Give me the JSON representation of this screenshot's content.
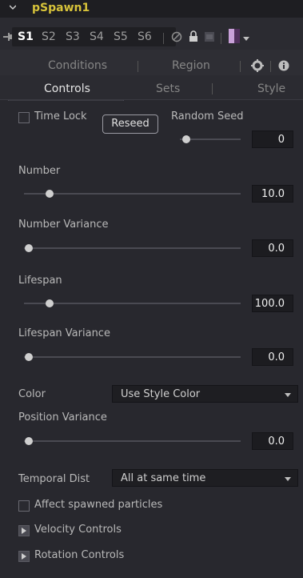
{
  "header": {
    "title": "pSpawn1"
  },
  "slots": [
    "S1",
    "S2",
    "S3",
    "S4",
    "S5",
    "S6"
  ],
  "tabs_top": [
    "Conditions",
    "Region"
  ],
  "tabs_bottom": [
    "Controls",
    "Sets",
    "Style"
  ],
  "controls": {
    "time_lock_label": "Time Lock",
    "reseed_label": "Reseed",
    "random_seed_label": "Random Seed",
    "random_seed_value": "0",
    "number_label": "Number",
    "number_value": "10.0",
    "number_variance_label": "Number Variance",
    "number_variance_value": "0.0",
    "lifespan_label": "Lifespan",
    "lifespan_value": "100.0",
    "lifespan_variance_label": "Lifespan Variance",
    "lifespan_variance_value": "0.0",
    "color_label": "Color",
    "color_option": "Use Style Color",
    "position_variance_label": "Position Variance",
    "position_variance_value": "0.0",
    "temporal_dist_label": "Temporal Dist",
    "temporal_dist_option": "All at same time",
    "affect_spawned_label": "Affect spawned particles",
    "velocity_controls_label": "Velocity Controls",
    "rotation_controls_label": "Rotation Controls"
  },
  "colors": {
    "title": "#d7c33a",
    "panel_bg": "#28282e",
    "swatch_a": "#c8a0d8",
    "swatch_b": "#50305c"
  },
  "icons": [
    "chevron-down-icon",
    "pin-icon",
    "disable-icon",
    "lock-icon",
    "cache-icon",
    "color-swatch-icon",
    "settings-icon",
    "info-icon",
    "expand-arrow-icon"
  ]
}
